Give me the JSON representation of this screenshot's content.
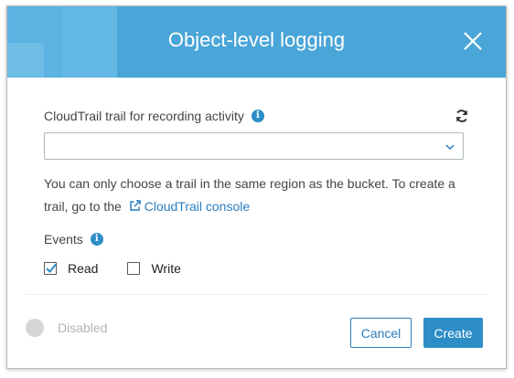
{
  "dialog": {
    "title": "Object-level logging"
  },
  "trail": {
    "label": "CloudTrail trail for recording activity",
    "selected_value": "",
    "help_text_before_link": "You can only choose a trail in the same region as the bucket. To create a trail, go to the",
    "link_label": "CloudTrail console"
  },
  "events": {
    "label": "Events",
    "options": [
      {
        "label": "Read",
        "checked": true
      },
      {
        "label": "Write",
        "checked": false
      }
    ]
  },
  "footer": {
    "toggle_label": "Disabled",
    "cancel_label": "Cancel",
    "create_label": "Create"
  },
  "colors": {
    "header_bg": "#4aa6d8",
    "primary": "#2d8ec7",
    "link": "#2b7ec1"
  },
  "icons": {
    "info": "info-icon",
    "refresh": "refresh-icon",
    "close": "close-icon",
    "external_link": "external-link-icon",
    "chevron": "chevron-down-icon"
  }
}
